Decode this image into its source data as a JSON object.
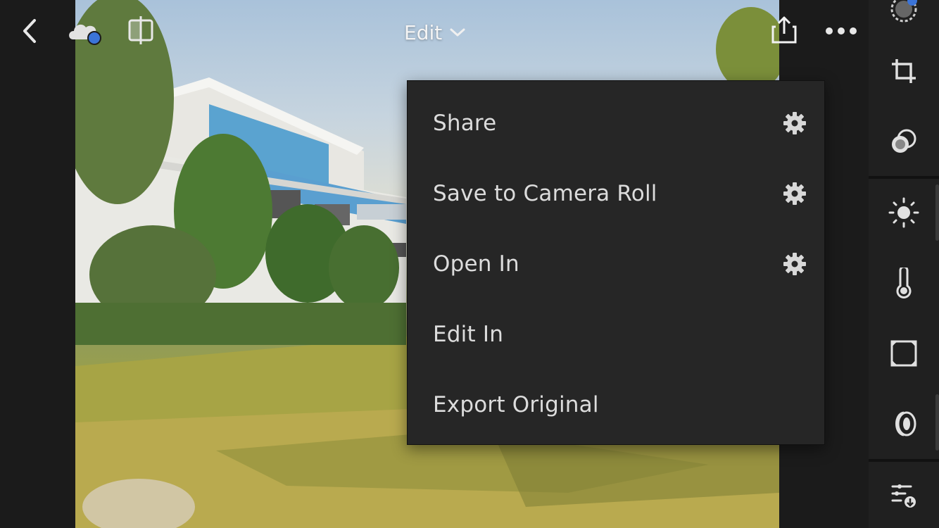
{
  "header": {
    "title": "Edit",
    "icons": {
      "back": "chevron-left-icon",
      "cloud": "cloud-sync-icon",
      "compare": "before-after-compare-icon",
      "title_dropdown": "chevron-down-icon",
      "share": "share-icon",
      "more": "more-icon"
    }
  },
  "share_menu": {
    "items": [
      {
        "label": "Share",
        "has_settings": true
      },
      {
        "label": "Save to Camera Roll",
        "has_settings": true
      },
      {
        "label": "Open In",
        "has_settings": true
      },
      {
        "label": "Edit In",
        "has_settings": false
      },
      {
        "label": "Export Original",
        "has_settings": false
      }
    ]
  },
  "tool_rail": {
    "tools": [
      "auto-icon",
      "crop-icon",
      "profiles-icon",
      "light-icon",
      "color-icon",
      "effects-icon",
      "optics-icon",
      "presets-icon"
    ]
  },
  "colors": {
    "menu_background": "#262626",
    "rail_background": "#202020",
    "app_background": "#1b1b1b",
    "cloud_badge": "#3b74d8"
  }
}
